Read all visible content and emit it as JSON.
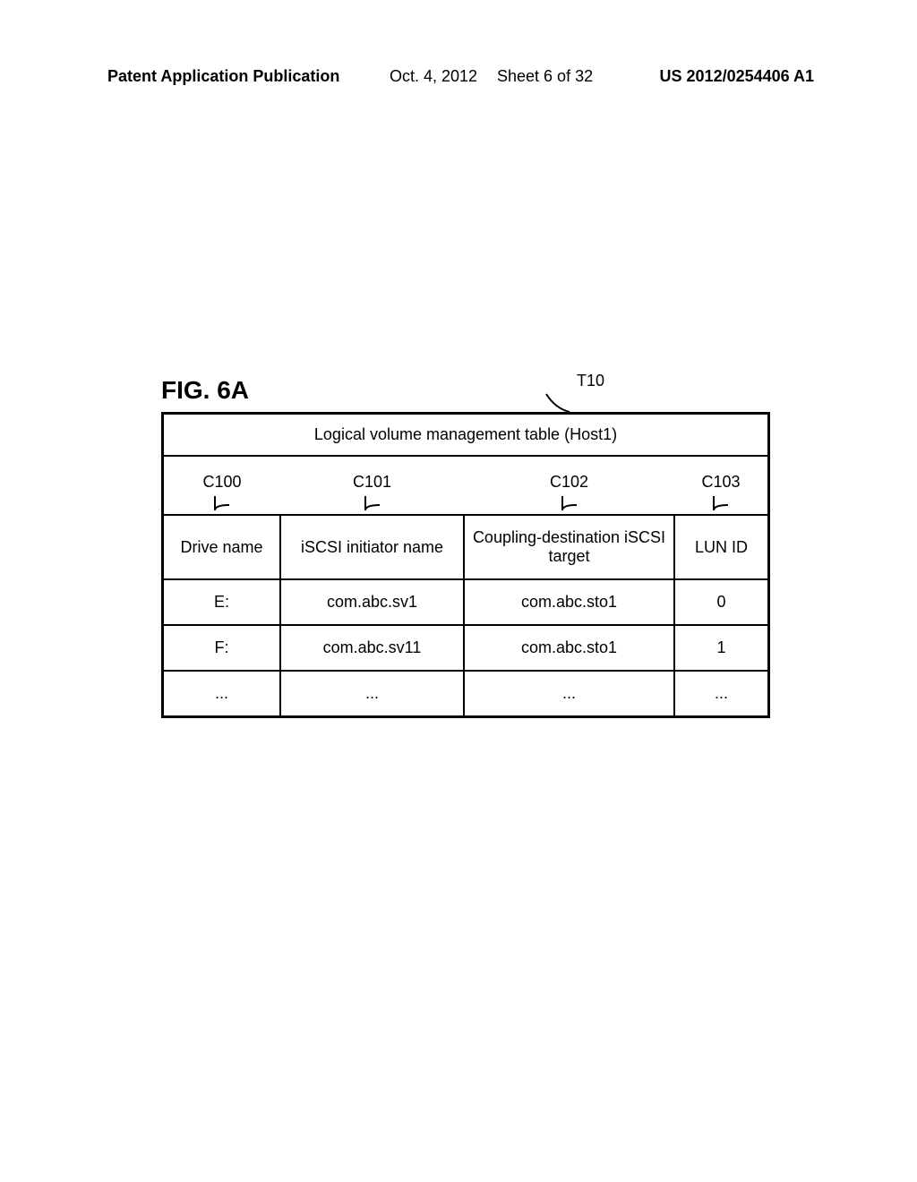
{
  "header": {
    "publication_type": "Patent Application Publication",
    "date": "Oct. 4, 2012",
    "sheet_info": "Sheet 6 of 32",
    "publication_number": "US 2012/0254406 A1"
  },
  "figure": {
    "label": "FIG. 6A",
    "table_ref": "T10"
  },
  "table": {
    "title": "Logical volume management table (Host1)",
    "column_refs": [
      "C100",
      "C101",
      "C102",
      "C103"
    ],
    "headers": [
      "Drive name",
      "iSCSI initiator name",
      "Coupling-destination iSCSI target",
      "LUN ID"
    ],
    "rows": [
      [
        "E:",
        "com.abc.sv1",
        "com.abc.sto1",
        "0"
      ],
      [
        "F:",
        "com.abc.sv11",
        "com.abc.sto1",
        "1"
      ],
      [
        "...",
        "...",
        "...",
        "..."
      ]
    ]
  }
}
